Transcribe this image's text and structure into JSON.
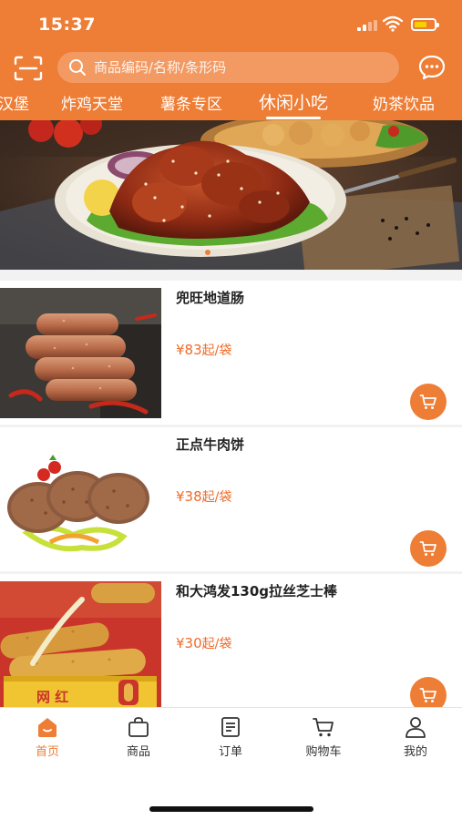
{
  "status_bar": {
    "time": "15:37"
  },
  "search": {
    "placeholder": "商品编码/名称/条形码"
  },
  "categories": {
    "items": [
      "汉堡",
      "炸鸡天堂",
      "薯条专区",
      "休闲小吃",
      "奶茶饮品"
    ],
    "active": "休闲小吃"
  },
  "products": [
    {
      "name": "兜旺地道肠",
      "price": "¥83",
      "unit": "起/袋"
    },
    {
      "name": "正点牛肉饼",
      "price": "¥38",
      "unit": "起/袋"
    },
    {
      "name": "和大鸿发130g拉丝芝士棒",
      "price": "¥30",
      "unit": "起/袋"
    }
  ],
  "tabbar": {
    "items": [
      {
        "label": "首页",
        "icon": "home-icon"
      },
      {
        "label": "商品",
        "icon": "bag-icon"
      },
      {
        "label": "订单",
        "icon": "order-icon"
      },
      {
        "label": "购物车",
        "icon": "cart-icon"
      },
      {
        "label": "我的",
        "icon": "profile-icon"
      }
    ],
    "active": "首页"
  },
  "colors": {
    "brand": "#ee7d35",
    "price": "#ef6b2a",
    "search_bg": "#f39a63"
  }
}
